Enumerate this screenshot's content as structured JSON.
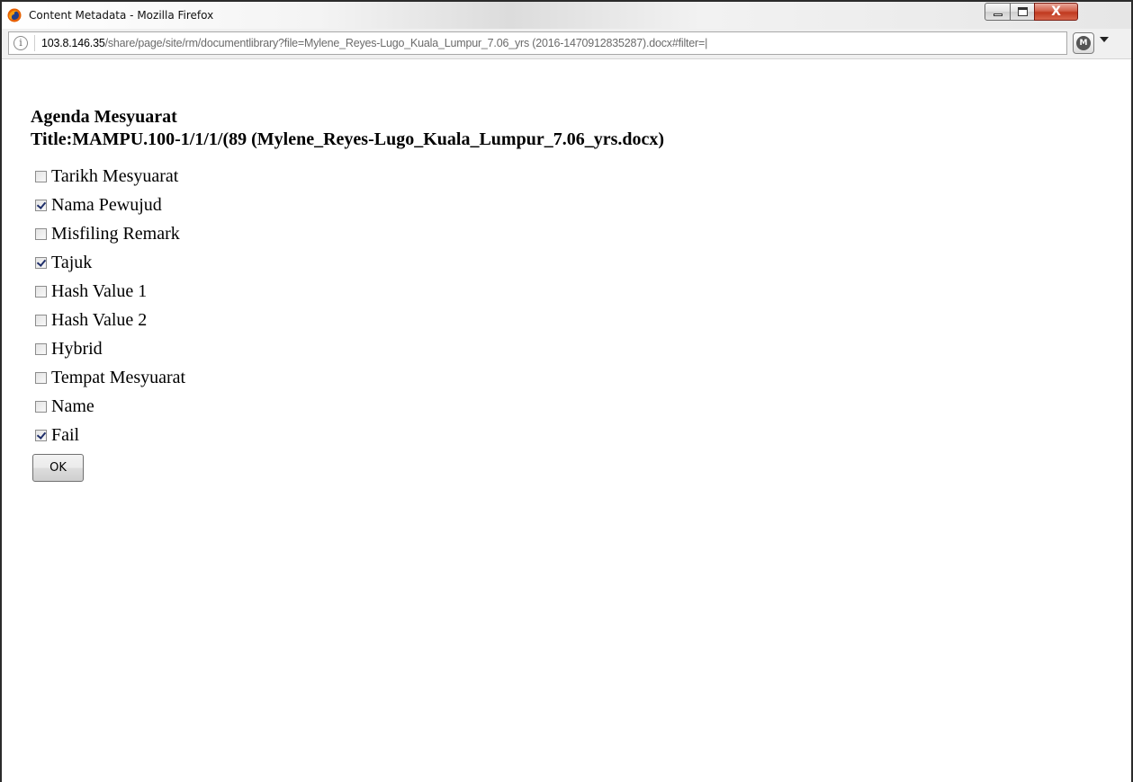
{
  "window": {
    "title": "Content Metadata - Mozilla Firefox",
    "icon": "firefox-icon",
    "controls": {
      "minimize": "minimize-icon",
      "maximize": "maximize-icon",
      "close": "X"
    }
  },
  "address_bar": {
    "host": "103.8.146.35",
    "path": "/share/page/site/rm/documentlibrary?file=Mylene_Reyes-Lugo_Kuala_Lumpur_7.06_yrs (2016-1470912835287).docx#filter=|",
    "info_icon": "info-icon",
    "extension_icon": "extension-icon",
    "menu_icon": "dropdown-arrow-icon"
  },
  "content": {
    "heading": "Agenda Mesyuarat",
    "title_line": "Title:MAMPU.100-1/1/1/(89 (Mylene_Reyes-Lugo_Kuala_Lumpur_7.06_yrs.docx)",
    "fields": [
      {
        "label": "Tarikh Mesyuarat",
        "checked": false
      },
      {
        "label": "Nama Pewujud",
        "checked": true
      },
      {
        "label": "Misfiling Remark",
        "checked": false
      },
      {
        "label": "Tajuk",
        "checked": true
      },
      {
        "label": "Hash Value 1",
        "checked": false
      },
      {
        "label": "Hash Value 2",
        "checked": false
      },
      {
        "label": "Hybrid",
        "checked": false
      },
      {
        "label": "Tempat Mesyuarat",
        "checked": false
      },
      {
        "label": "Name",
        "checked": false
      },
      {
        "label": "Fail",
        "checked": true
      }
    ],
    "ok_label": "OK"
  },
  "colors": {
    "close_button": "#c9452a",
    "checkmark": "#1f2f6b",
    "url_host": "#000000",
    "url_path": "#6b6b6b"
  }
}
